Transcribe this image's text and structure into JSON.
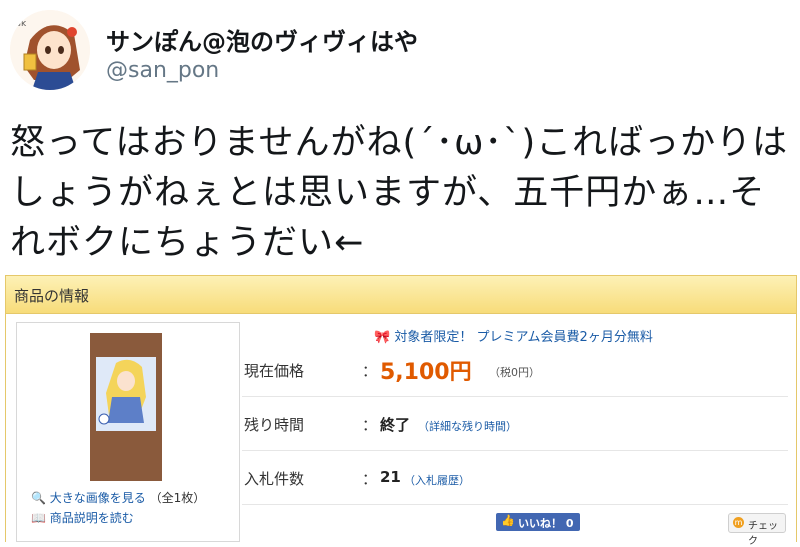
{
  "tweet": {
    "display_name": "サンぽん@泡のヴィヴィはや",
    "handle": "@san_pon",
    "text": "怒ってはおりませんがね(´･ω･`)こればっかりは\nしょうがねぇとは思いますが、五千円かぁ…そ\nれボクにちょうだい←",
    "avatar_icon": "anime-character-avatar"
  },
  "auction": {
    "header_title": "商品の情報",
    "promo_text": "対象者限定！ プレミアム会員費2ヶ月分無料",
    "promo_icon": "ribbon-icon",
    "price_label": "現在価格",
    "price_value": "5,100円",
    "tax_note": "（税0円）",
    "time_label": "残り時間",
    "time_value": "終了",
    "time_detail_link": "（詳細な残り時間）",
    "bids_label": "入札件数",
    "bids_value": "21",
    "bids_history_link": "（入札履歴）",
    "colon": "：",
    "enlarge_link": "大きな画像を見る",
    "enlarge_count": "（全1枚）",
    "description_link": "商品説明を読む",
    "like_button": "いいね！ 0",
    "check_button": "チェック",
    "colors": {
      "price": "#e05a00",
      "link": "#1a5ba6",
      "header": "#f7dc7a",
      "like": "#4267b2"
    }
  }
}
